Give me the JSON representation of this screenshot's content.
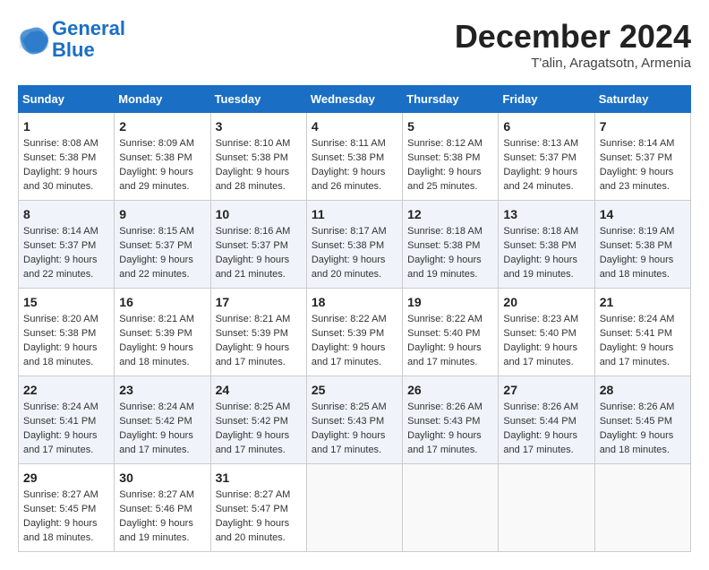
{
  "header": {
    "logo_line1": "General",
    "logo_line2": "Blue",
    "month": "December 2024",
    "location": "T'alin, Aragatsotn, Armenia"
  },
  "days_of_week": [
    "Sunday",
    "Monday",
    "Tuesday",
    "Wednesday",
    "Thursday",
    "Friday",
    "Saturday"
  ],
  "weeks": [
    [
      {
        "day": "1",
        "info": "Sunrise: 8:08 AM\nSunset: 5:38 PM\nDaylight: 9 hours and 30 minutes."
      },
      {
        "day": "2",
        "info": "Sunrise: 8:09 AM\nSunset: 5:38 PM\nDaylight: 9 hours and 29 minutes."
      },
      {
        "day": "3",
        "info": "Sunrise: 8:10 AM\nSunset: 5:38 PM\nDaylight: 9 hours and 28 minutes."
      },
      {
        "day": "4",
        "info": "Sunrise: 8:11 AM\nSunset: 5:38 PM\nDaylight: 9 hours and 26 minutes."
      },
      {
        "day": "5",
        "info": "Sunrise: 8:12 AM\nSunset: 5:38 PM\nDaylight: 9 hours and 25 minutes."
      },
      {
        "day": "6",
        "info": "Sunrise: 8:13 AM\nSunset: 5:37 PM\nDaylight: 9 hours and 24 minutes."
      },
      {
        "day": "7",
        "info": "Sunrise: 8:14 AM\nSunset: 5:37 PM\nDaylight: 9 hours and 23 minutes."
      }
    ],
    [
      {
        "day": "8",
        "info": "Sunrise: 8:14 AM\nSunset: 5:37 PM\nDaylight: 9 hours and 22 minutes."
      },
      {
        "day": "9",
        "info": "Sunrise: 8:15 AM\nSunset: 5:37 PM\nDaylight: 9 hours and 22 minutes."
      },
      {
        "day": "10",
        "info": "Sunrise: 8:16 AM\nSunset: 5:37 PM\nDaylight: 9 hours and 21 minutes."
      },
      {
        "day": "11",
        "info": "Sunrise: 8:17 AM\nSunset: 5:38 PM\nDaylight: 9 hours and 20 minutes."
      },
      {
        "day": "12",
        "info": "Sunrise: 8:18 AM\nSunset: 5:38 PM\nDaylight: 9 hours and 19 minutes."
      },
      {
        "day": "13",
        "info": "Sunrise: 8:18 AM\nSunset: 5:38 PM\nDaylight: 9 hours and 19 minutes."
      },
      {
        "day": "14",
        "info": "Sunrise: 8:19 AM\nSunset: 5:38 PM\nDaylight: 9 hours and 18 minutes."
      }
    ],
    [
      {
        "day": "15",
        "info": "Sunrise: 8:20 AM\nSunset: 5:38 PM\nDaylight: 9 hours and 18 minutes."
      },
      {
        "day": "16",
        "info": "Sunrise: 8:21 AM\nSunset: 5:39 PM\nDaylight: 9 hours and 18 minutes."
      },
      {
        "day": "17",
        "info": "Sunrise: 8:21 AM\nSunset: 5:39 PM\nDaylight: 9 hours and 17 minutes."
      },
      {
        "day": "18",
        "info": "Sunrise: 8:22 AM\nSunset: 5:39 PM\nDaylight: 9 hours and 17 minutes."
      },
      {
        "day": "19",
        "info": "Sunrise: 8:22 AM\nSunset: 5:40 PM\nDaylight: 9 hours and 17 minutes."
      },
      {
        "day": "20",
        "info": "Sunrise: 8:23 AM\nSunset: 5:40 PM\nDaylight: 9 hours and 17 minutes."
      },
      {
        "day": "21",
        "info": "Sunrise: 8:24 AM\nSunset: 5:41 PM\nDaylight: 9 hours and 17 minutes."
      }
    ],
    [
      {
        "day": "22",
        "info": "Sunrise: 8:24 AM\nSunset: 5:41 PM\nDaylight: 9 hours and 17 minutes."
      },
      {
        "day": "23",
        "info": "Sunrise: 8:24 AM\nSunset: 5:42 PM\nDaylight: 9 hours and 17 minutes."
      },
      {
        "day": "24",
        "info": "Sunrise: 8:25 AM\nSunset: 5:42 PM\nDaylight: 9 hours and 17 minutes."
      },
      {
        "day": "25",
        "info": "Sunrise: 8:25 AM\nSunset: 5:43 PM\nDaylight: 9 hours and 17 minutes."
      },
      {
        "day": "26",
        "info": "Sunrise: 8:26 AM\nSunset: 5:43 PM\nDaylight: 9 hours and 17 minutes."
      },
      {
        "day": "27",
        "info": "Sunrise: 8:26 AM\nSunset: 5:44 PM\nDaylight: 9 hours and 17 minutes."
      },
      {
        "day": "28",
        "info": "Sunrise: 8:26 AM\nSunset: 5:45 PM\nDaylight: 9 hours and 18 minutes."
      }
    ],
    [
      {
        "day": "29",
        "info": "Sunrise: 8:27 AM\nSunset: 5:45 PM\nDaylight: 9 hours and 18 minutes."
      },
      {
        "day": "30",
        "info": "Sunrise: 8:27 AM\nSunset: 5:46 PM\nDaylight: 9 hours and 19 minutes."
      },
      {
        "day": "31",
        "info": "Sunrise: 8:27 AM\nSunset: 5:47 PM\nDaylight: 9 hours and 20 minutes."
      },
      {
        "day": "",
        "info": ""
      },
      {
        "day": "",
        "info": ""
      },
      {
        "day": "",
        "info": ""
      },
      {
        "day": "",
        "info": ""
      }
    ]
  ]
}
